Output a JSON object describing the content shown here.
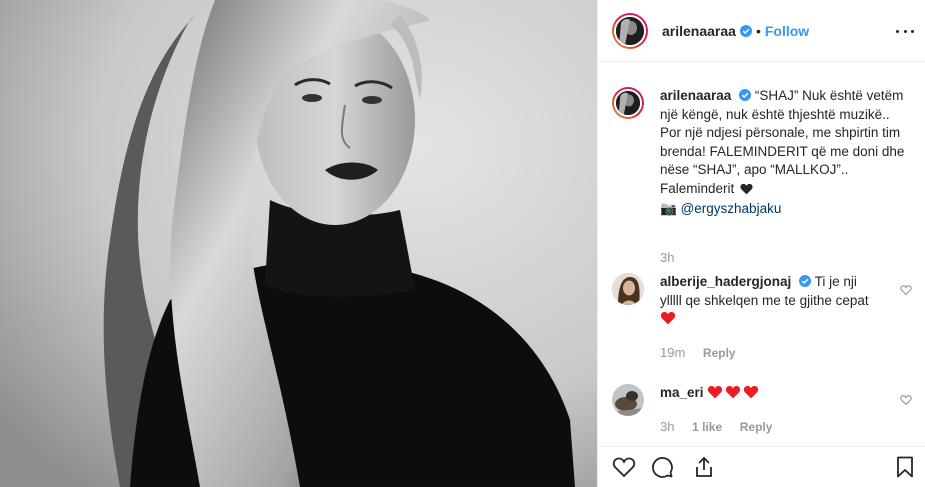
{
  "post": {
    "author": "arilenaaraa",
    "follow_label": "Follow",
    "separator": "•"
  },
  "caption": {
    "author": "arilenaaraa",
    "line1": "“SHAJ”",
    "text": "Nuk është vetëm një këngë, nuk është thjeshtë muzikë.. Por një ndjesi përsonale, me shpirtin tim brenda! FALEMINDERIT që me doni dhe nëse “SHAJ”, apo “MALLKOJ”.. Faleminderit",
    "camera_emoji": "📷",
    "mention": "@ergyszhabjaku",
    "time": "3h"
  },
  "comments": [
    {
      "author": "alberije_hadergjonaj",
      "text": "Ti je nji ylllll qe shkelqen me te gjithe cepat",
      "time": "19m",
      "reply_label": "Reply"
    },
    {
      "author": "ma_eri",
      "text": "",
      "time": "3h",
      "likes_label": "1 like",
      "reply_label": "Reply"
    }
  ],
  "colors": {
    "link": "#3897f0",
    "text": "#262626",
    "muted": "#999999",
    "heart": "#ed4956",
    "verified": "#3897f0"
  },
  "icons": [
    "more-options-icon",
    "verified-badge-icon",
    "heart-icon",
    "comment-icon",
    "share-icon",
    "bookmark-icon",
    "camera-icon"
  ]
}
